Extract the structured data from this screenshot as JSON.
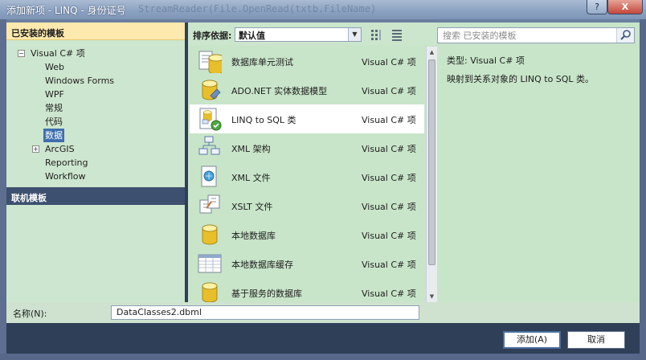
{
  "window": {
    "title": "添加新项 - LINQ - 身份证号",
    "background_text": "StreamReader(File.OpenRead(txtb.FileName)",
    "help_label": "?",
    "close_label": "X"
  },
  "left_panel": {
    "installed_header": "已安装的模板",
    "online_header": "联机模板",
    "tree": [
      {
        "label": "Visual C# 项",
        "expander": "−",
        "level": 0
      },
      {
        "label": "Web",
        "level": 1
      },
      {
        "label": "Windows Forms",
        "level": 1
      },
      {
        "label": "WPF",
        "level": 1
      },
      {
        "label": "常规",
        "level": 1
      },
      {
        "label": "代码",
        "level": 1
      },
      {
        "label": "数据",
        "level": 1,
        "selected": true
      },
      {
        "label": "ArcGIS",
        "expander": "+",
        "level": 1
      },
      {
        "label": "Reporting",
        "level": 1
      },
      {
        "label": "Workflow",
        "level": 1
      }
    ]
  },
  "toolbar": {
    "sort_label": "排序依据:",
    "sort_value": "默认值",
    "view_icons": [
      "small-icons-view-icon",
      "list-view-icon"
    ]
  },
  "templates": [
    {
      "name": "数据库单元测试",
      "lang": "Visual C# 项",
      "icon": "database-unit-test-icon"
    },
    {
      "name": "ADO.NET 实体数据模型",
      "lang": "Visual C# 项",
      "icon": "entity-model-icon"
    },
    {
      "name": "LINQ to SQL 类",
      "lang": "Visual C# 项",
      "icon": "linq-to-sql-icon",
      "selected": true
    },
    {
      "name": "XML 架构",
      "lang": "Visual C# 项",
      "icon": "xml-schema-icon"
    },
    {
      "name": "XML 文件",
      "lang": "Visual C# 项",
      "icon": "xml-file-icon"
    },
    {
      "name": "XSLT 文件",
      "lang": "Visual C# 项",
      "icon": "xslt-file-icon"
    },
    {
      "name": "本地数据库",
      "lang": "Visual C# 项",
      "icon": "local-database-icon"
    },
    {
      "name": "本地数据库缓存",
      "lang": "Visual C# 项",
      "icon": "local-database-cache-icon"
    },
    {
      "name": "基于服务的数据库",
      "lang": "Visual C# 项",
      "icon": "service-database-icon"
    }
  ],
  "details": {
    "search_placeholder": "搜索 已安装的模板",
    "type_line": "类型:  Visual C# 项",
    "description": "映射到关系对象的 LINQ to SQL 类。"
  },
  "footer": {
    "name_label": "名称(N):",
    "name_value": "DataClasses2.dbml",
    "add_button": "添加(A)",
    "cancel_button": "取消"
  },
  "colors": {
    "panel_green": "#c8e5c9",
    "header_yellow": "#fde9ae",
    "selected_blue": "#3e6fad",
    "frame_navy": "#2f3f58"
  }
}
